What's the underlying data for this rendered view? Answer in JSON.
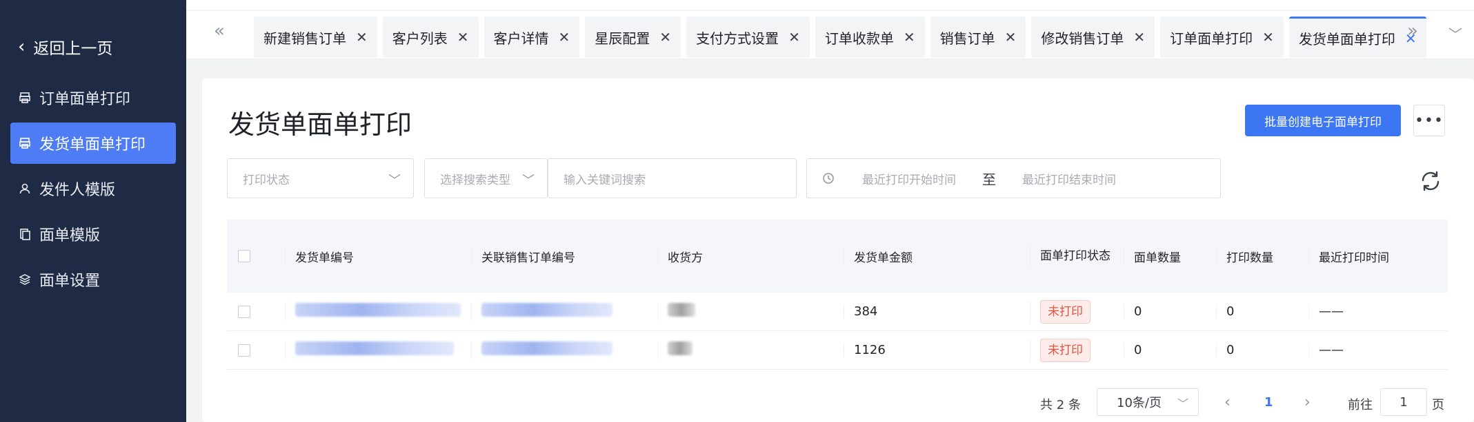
{
  "sidebar": {
    "back_label": "返回上一页",
    "items": [
      {
        "label": "订单面单打印",
        "icon": "printer-icon"
      },
      {
        "label": "发货单面单打印",
        "icon": "printer-icon",
        "active": true
      },
      {
        "label": "发件人模版",
        "icon": "user-icon"
      },
      {
        "label": "面单模版",
        "icon": "document-icon"
      },
      {
        "label": "面单设置",
        "icon": "layers-icon"
      }
    ]
  },
  "tabs": [
    {
      "label": "新建销售订单"
    },
    {
      "label": "客户列表"
    },
    {
      "label": "客户详情"
    },
    {
      "label": "星辰配置"
    },
    {
      "label": "支付方式设置"
    },
    {
      "label": "订单收款单"
    },
    {
      "label": "销售订单"
    },
    {
      "label": "修改销售订单"
    },
    {
      "label": "订单面单打印"
    },
    {
      "label": "发货单面单打印",
      "active": true
    }
  ],
  "page": {
    "title": "发货单面单打印",
    "batch_button": "批量创建电子面单打印",
    "more_button": "•••"
  },
  "filters": {
    "print_status_placeholder": "打印状态",
    "search_type_placeholder": "选择搜索类型",
    "keyword_placeholder": "输入关键词搜索",
    "start_time_placeholder": "最近打印开始时间",
    "range_separator": "至",
    "end_time_placeholder": "最近打印结束时间"
  },
  "table": {
    "headers": [
      "发货单编号",
      "关联销售订单编号",
      "收货方",
      "发货单金额",
      "面单打印状态",
      "面单数量",
      "打印数量",
      "最近打印时间"
    ],
    "rows": [
      {
        "amount": "384",
        "status": "未打印",
        "label_count": "0",
        "print_count": "0",
        "last_print": "——"
      },
      {
        "amount": "1126",
        "status": "未打印",
        "label_count": "0",
        "print_count": "0",
        "last_print": "——"
      }
    ]
  },
  "pagination": {
    "total": "共 2 条",
    "page_size": "10条/页",
    "current_page": "1",
    "goto_label": "前往",
    "goto_value": "1",
    "page_suffix": "页"
  },
  "colors": {
    "sidebar_bg": "#1f2a44",
    "accent": "#3c76f2",
    "status_unprinted": "#e5533d"
  }
}
